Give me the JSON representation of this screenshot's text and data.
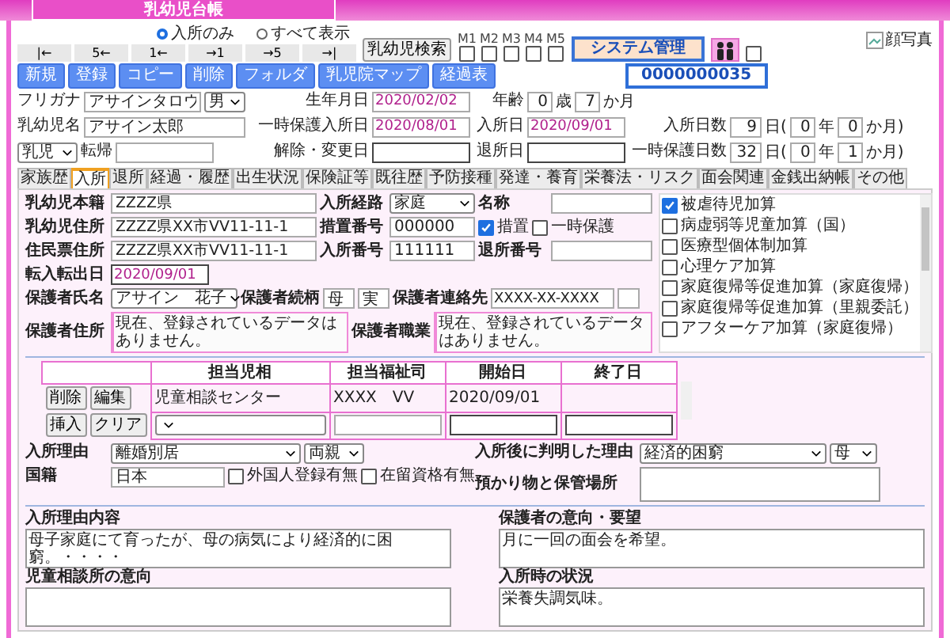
{
  "title": "乳幼児台帳",
  "header": {
    "view_filter": [
      {
        "label": "入所のみ",
        "selected": true
      },
      {
        "label": "すべて表示",
        "selected": false
      }
    ],
    "nav_buttons": [
      "|←",
      "5←",
      "1←",
      "→1",
      "→5",
      "→|"
    ],
    "search_button": "乳幼児検索",
    "marks": [
      {
        "label": "M1",
        "checked": false
      },
      {
        "label": "M2",
        "checked": false
      },
      {
        "label": "M3",
        "checked": false
      },
      {
        "label": "M4",
        "checked": false
      },
      {
        "label": "M5",
        "checked": false
      }
    ],
    "admin_button": "システム管理",
    "extra_checkbox": {
      "checked": false
    },
    "photo_alt": "顔写真",
    "action_buttons": [
      "新規",
      "登録",
      "コピー",
      "削除",
      "フォルダ",
      "乳児院マップ",
      "経過表"
    ],
    "record_id": "0000000035",
    "furigana": {
      "label": "フリガナ",
      "value": "アサインタロウ"
    },
    "sex": "男",
    "name": {
      "label": "乳幼児名",
      "value": "アサイン太郎"
    },
    "category": "乳児",
    "outcome": {
      "label": "転帰"
    },
    "birth_date": {
      "label": "生年月日",
      "value": "2020/02/02"
    },
    "temp_admission_date": {
      "label": "一時保護入所日",
      "value": "2020/08/01"
    },
    "release_date": {
      "label": "解除・変更日"
    },
    "age": {
      "label": "年齢",
      "years": "0",
      "years_unit": "歳",
      "months": "7",
      "months_unit": "か月"
    },
    "admission_date": {
      "label": "入所日",
      "value": "2020/09/01"
    },
    "discharge_date": {
      "label": "退所日"
    },
    "durations": [
      {
        "label": "入所日数",
        "days": "9",
        "days_unit": "日(",
        "years": "0",
        "years_unit": "年",
        "months": "0",
        "months_unit": "か月)"
      },
      {
        "label": "一時保護日数",
        "days": "32",
        "days_unit": "日(",
        "years": "0",
        "years_unit": "年",
        "months": "1",
        "months_unit": "か月)"
      }
    ]
  },
  "tabs": [
    {
      "label": "家族歴",
      "selected": false
    },
    {
      "label": "入所",
      "selected": true
    },
    {
      "label": "退所",
      "selected": false
    },
    {
      "label": "経過・履歴",
      "selected": false
    },
    {
      "label": "出生状況",
      "selected": false
    },
    {
      "label": "保険証等",
      "selected": false
    },
    {
      "label": "既往歴",
      "selected": false
    },
    {
      "label": "予防接種",
      "selected": false
    },
    {
      "label": "発達・養育",
      "selected": false
    },
    {
      "label": "栄養法・リスク",
      "selected": false
    },
    {
      "label": "面会関連",
      "selected": false
    },
    {
      "label": "金銭出納帳",
      "selected": false
    },
    {
      "label": "その他",
      "selected": false
    }
  ],
  "details": {
    "domicile": {
      "label": "乳幼児本籍",
      "value": "ZZZZ県"
    },
    "address": {
      "label": "乳幼児住所",
      "value": "ZZZZ県XX市VV11-11-1"
    },
    "resident_address": {
      "label": "住民票住所",
      "value": "ZZZZ県XX市VV11-11-1"
    },
    "transfer_date": {
      "label": "転入転出日",
      "value": "2020/09/01"
    },
    "route": {
      "label": "入所経路",
      "value": "家庭"
    },
    "facility_name": {
      "label": "名称"
    },
    "placement_no": {
      "label": "措置番号",
      "value": "000000"
    },
    "placement": {
      "label": "措置",
      "checked": true
    },
    "temp_protection": {
      "label": "一時保護",
      "checked": false
    },
    "admission_no": {
      "label": "入所番号",
      "value": "111111"
    },
    "discharge_no": {
      "label": "退所番号"
    },
    "guardian_name": {
      "label": "保護者氏名",
      "value": "アサイン　花子"
    },
    "relation": {
      "label": "保護者続柄",
      "value": "母",
      "type": "実"
    },
    "contact": {
      "label": "保護者連絡先",
      "value": "XXXX-XX-XXXX"
    },
    "guardian_address": {
      "label": "保護者住所",
      "value": "現在、登録されているデータはありません。"
    },
    "guardian_job": {
      "label": "保護者職業",
      "value": "現在、登録されているデータはありません。"
    },
    "allowances": [
      {
        "label": "被虐待児加算",
        "checked": true
      },
      {
        "label": "病虚弱等児童加算（国）",
        "checked": false
      },
      {
        "label": "医療型個体制加算",
        "checked": false
      },
      {
        "label": "心理ケア加算",
        "checked": false
      },
      {
        "label": "家庭復帰等促進加算（家庭復帰）",
        "checked": false
      },
      {
        "label": "家庭復帰等促進加算（里親委託）",
        "checked": false
      },
      {
        "label": "アフターケア加算（家庭復帰）",
        "checked": false
      }
    ]
  },
  "assignments": {
    "columns": [
      "担当児相",
      "担当福祉司",
      "開始日",
      "終了日"
    ],
    "row_buttons": [
      "削除",
      "編集"
    ],
    "rows": [
      {
        "office": "児童相談センター",
        "worker": "XXXX　VV",
        "start": "2020/09/01"
      }
    ],
    "new_row_buttons": [
      "挿入",
      "クリア"
    ]
  },
  "reasons": {
    "admission_reason": {
      "label": "入所理由",
      "value": "離婚別居",
      "person": "両親"
    },
    "later_reason": {
      "label": "入所後に判明した理由",
      "value": "経済的困窮",
      "person": "母"
    },
    "nationality": {
      "label": "国籍",
      "value": "日本"
    },
    "foreign_registration": {
      "label": "外国人登録有無",
      "checked": false
    },
    "residence_status": {
      "label": "在留資格有無",
      "checked": false
    },
    "belongings": {
      "label": "預かり物と保管場所"
    }
  },
  "notes": [
    {
      "label": "入所理由内容",
      "value": "母子家庭にて育ったが、母の病気により経済的に困窮。・・・・"
    },
    {
      "label": "保護者の意向・要望",
      "value": "月に一回の面会を希望。"
    },
    {
      "label": "児童相談所の意向"
    },
    {
      "label": "入所時の状況",
      "value": "栄養失調気味。"
    }
  ]
}
